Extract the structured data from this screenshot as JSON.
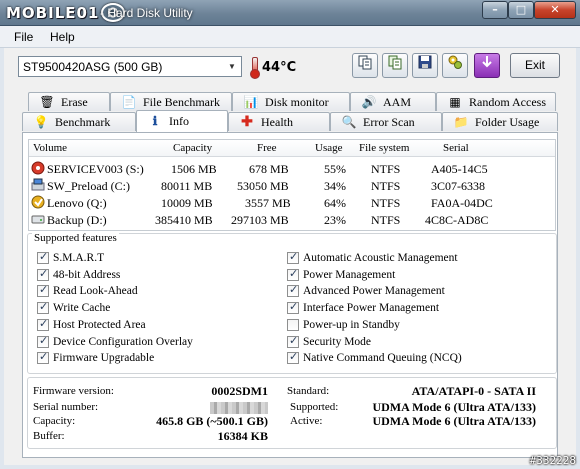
{
  "window": {
    "logo_text": "MOBILE01",
    "title": "- Hard Disk Utility",
    "minimize": "–",
    "maximize": "□",
    "close": "✕"
  },
  "menu": {
    "file": "File",
    "help": "Help"
  },
  "toolbar": {
    "drive_selected": "ST9500420ASG (500 GB)",
    "temperature": "44°C",
    "exit_label": "Exit",
    "buttons": [
      {
        "icon": "copy-info-icon"
      },
      {
        "icon": "copy-report-icon"
      },
      {
        "icon": "save-icon"
      },
      {
        "icon": "options-icon"
      },
      {
        "icon": "menu-down-icon"
      }
    ]
  },
  "tabs_row1": [
    "Erase",
    "File Benchmark",
    "Disk monitor",
    "AAM",
    "Random Access"
  ],
  "tabs_row2": [
    "Benchmark",
    "Info",
    "Health",
    "Error Scan",
    "Folder Usage"
  ],
  "active_tab": "Info",
  "volumes": {
    "headers": [
      "Volume",
      "Capacity",
      "Free",
      "Usage",
      "File system",
      "Serial"
    ],
    "rows": [
      {
        "volume": "SERVICEV003 (S:)",
        "capacity": "1506 MB",
        "free": "678 MB",
        "usage": "55%",
        "fs": "NTFS",
        "serial": "A405-14C5"
      },
      {
        "volume": "SW_Preload (C:)",
        "capacity": "80011 MB",
        "free": "53050 MB",
        "usage": "34%",
        "fs": "NTFS",
        "serial": "3C07-6338"
      },
      {
        "volume": "Lenovo (Q:)",
        "capacity": "10009 MB",
        "free": "3557 MB",
        "usage": "64%",
        "fs": "NTFS",
        "serial": "FA0A-04DC"
      },
      {
        "volume": "Backup (D:)",
        "capacity": "385410 MB",
        "free": "297103 MB",
        "usage": "23%",
        "fs": "NTFS",
        "serial": "4C8C-AD8C"
      }
    ]
  },
  "features": {
    "legend": "Supported features",
    "left": [
      {
        "label": "S.M.A.R.T",
        "checked": true
      },
      {
        "label": "48-bit Address",
        "checked": true
      },
      {
        "label": "Read Look-Ahead",
        "checked": true
      },
      {
        "label": "Write Cache",
        "checked": true
      },
      {
        "label": "Host Protected Area",
        "checked": true
      },
      {
        "label": "Device Configuration Overlay",
        "checked": true
      },
      {
        "label": "Firmware Upgradable",
        "checked": true
      }
    ],
    "right": [
      {
        "label": "Automatic Acoustic Management",
        "checked": true
      },
      {
        "label": "Power Management",
        "checked": true
      },
      {
        "label": "Advanced Power Management",
        "checked": true
      },
      {
        "label": "Interface Power Management",
        "checked": true
      },
      {
        "label": "Power-up in Standby",
        "checked": false
      },
      {
        "label": "Security Mode",
        "checked": true
      },
      {
        "label": "Native Command Queuing (NCQ)",
        "checked": true
      }
    ]
  },
  "info": {
    "firmware_label": "Firmware version:",
    "firmware_value": "0002SDM1",
    "serial_label": "Serial number:",
    "capacity_label": "Capacity:",
    "capacity_value": "465.8 GB (~500.1 GB)",
    "buffer_label": "Buffer:",
    "buffer_value": "16384 KB",
    "standard_label": "Standard:",
    "standard_value": "ATA/ATAPI-0 - SATA II",
    "supported_label": "Supported:",
    "supported_value": "UDMA Mode 6 (Ultra ATA/133)",
    "active_label": "Active:",
    "active_value": "UDMA Mode 6 (Ultra ATA/133)"
  },
  "watermark": "#332228"
}
